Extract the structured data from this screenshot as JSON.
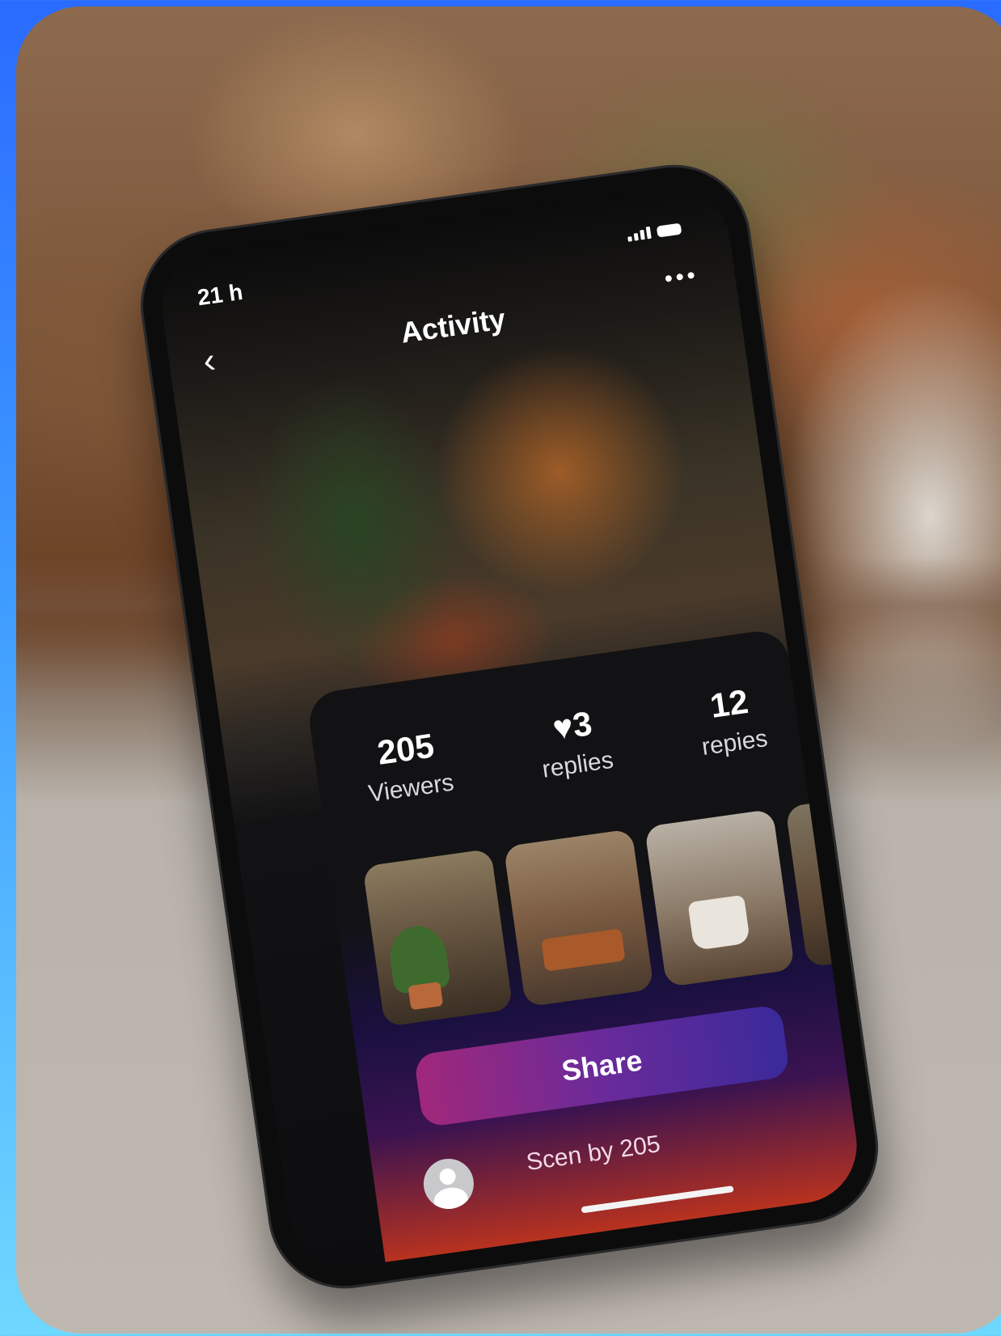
{
  "status_bar": {
    "time": "21 h"
  },
  "header": {
    "title": "Activity"
  },
  "stats": [
    {
      "value": "205",
      "label": "Viewers"
    },
    {
      "value": "♥3",
      "label": "replies"
    },
    {
      "value": "12",
      "label": "repies"
    }
  ],
  "actions": {
    "share_label": "Share"
  },
  "footer": {
    "seen_by": "Scen by 205"
  },
  "thumbnails": [
    {
      "icon": "plant-photo"
    },
    {
      "icon": "room-photo"
    },
    {
      "icon": "mug-photo"
    },
    {
      "icon": "plant-photo-partial"
    }
  ],
  "colors": {
    "share_gradient_start": "#a0287a",
    "share_gradient_end": "#3a2a9a",
    "background_blue": "#3f9cff"
  }
}
